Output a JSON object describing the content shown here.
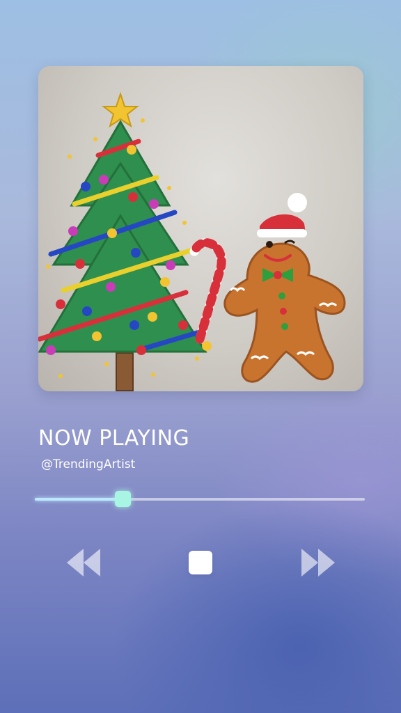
{
  "player": {
    "title": "NOW PLAYING",
    "artist": "@TrendingArtist",
    "progress_fraction": 0.265
  },
  "controls": {
    "rewind_icon": "rewind-icon",
    "stop_icon": "stop-icon",
    "fast_forward_icon": "fast-forward-icon"
  },
  "artwork": {
    "description_icons": [
      "christmas-tree-icon",
      "gingerbread-man-icon",
      "candy-cane-icon"
    ]
  },
  "colors": {
    "progress_fill": "#bde8ff",
    "thumb": "#a9f5e3",
    "control_icons": "#ffffff"
  }
}
